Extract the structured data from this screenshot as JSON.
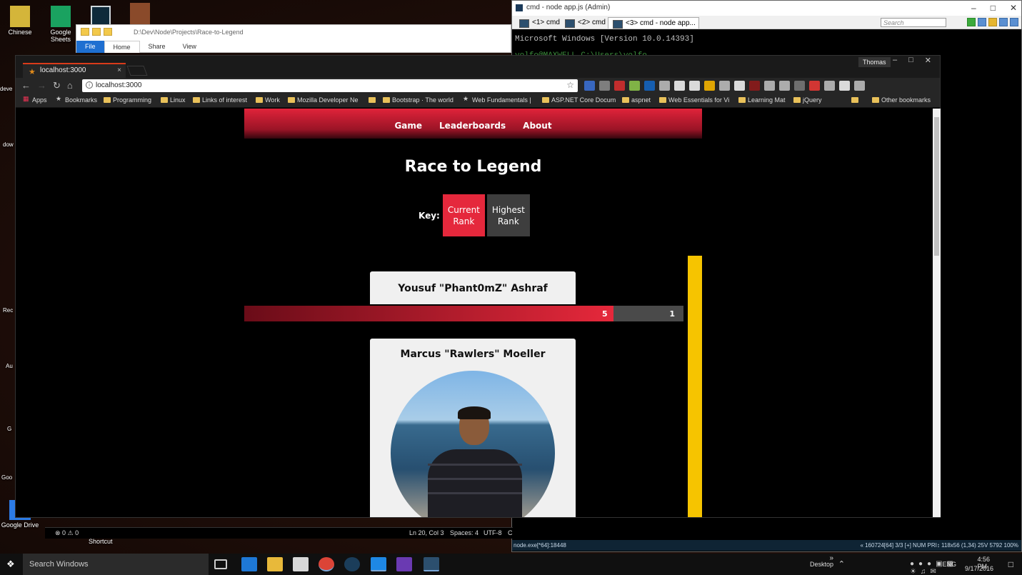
{
  "desktop": {
    "icons": [
      {
        "label": "Chinese",
        "icon": "folder-icon",
        "color": "#d4b53a"
      },
      {
        "label": "Google Sheets",
        "icon": "sheets-icon",
        "color": "#1aa260"
      },
      {
        "label": "Google Drive",
        "icon": "drive-icon",
        "color": "#2c7be5"
      }
    ],
    "fragments": [
      "deve",
      "dow",
      "Rec",
      "Au",
      "G",
      "Goo"
    ]
  },
  "explorer": {
    "path": "D:\\Dev\\Node\\Projects\\Race-to-Legend",
    "tabs": [
      "File",
      "Home",
      "Share",
      "View"
    ]
  },
  "cmd": {
    "title": "cmd - node  app.js (Admin)",
    "tabs": [
      "<1> cmd",
      "<2> cmd",
      "<3> cmd - node  app..."
    ],
    "search_placeholder": "Search",
    "console_lines": [
      "Microsoft Windows [Version 10.0.14393]",
      "yolfo@MAXWELL C:\\Users\\yolfo"
    ],
    "status": {
      "process": "node.exe[*64]:18448",
      "info": "« 160724[64]  3/3  [+]  NUM  PRI↕  118x56   (1,34) 25V   5792  100%"
    },
    "window_controls": [
      "–",
      "□",
      "✕"
    ]
  },
  "chrome": {
    "tab_title": "localhost:3000",
    "tab_close": "×",
    "profile": "Thomas",
    "window_controls": [
      "–",
      "□",
      "✕"
    ],
    "url": "localhost:3000",
    "bookmarks": [
      "Apps",
      "Bookmarks",
      "Programming",
      "Linux",
      "Links of interest",
      "Work",
      "Mozilla Developer Ne",
      "",
      "Bootstrap · The world",
      "Web Fundamentals | ",
      "ASP.NET Core Docum",
      "aspnet",
      "Web Essentials for Vi",
      "Learning Mat",
      "jQuery",
      "»",
      "Other bookmarks"
    ],
    "extension_colors": [
      "#3b6fd1",
      "#888888",
      "#d32f2f",
      "#8bc34a",
      "#1565c0",
      "#bbbbbb",
      "#eeeeee",
      "#eeeeee",
      "#f4b400",
      "#bbbbbb",
      "#eeeeee",
      "#8d1b1b",
      "#bbbbbb",
      "#bbbbbb",
      "#777777",
      "#e53935",
      "#bbbbbb",
      "#eeeeee",
      "#bbbbbb"
    ]
  },
  "site": {
    "nav": [
      "Game",
      "Leaderboards",
      "About"
    ],
    "title": "Race to Legend",
    "key_label": "Key:",
    "key_current": "Current Rank",
    "key_highest": "Highest Rank",
    "colors": {
      "current": "#e5283c",
      "highest": "#3e3e3e",
      "accent": "#f6c400"
    },
    "players": [
      {
        "name": "Yousuf \"Phant0mZ\" Ashraf",
        "current_rank": "5",
        "highest_rank": "1",
        "current_fill_fraction": 0.84
      },
      {
        "name": "Marcus \"Rawlers\" Moeller",
        "avatar": "profile-photo"
      }
    ]
  },
  "vscode_status": {
    "problems": "⊗ 0  ⚠ 0",
    "position": "Ln 20, Col 3",
    "spaces": "Spaces: 4",
    "encoding": "UTF-8",
    "extra": "C"
  },
  "desktop_shortcut": "Shortcut",
  "taskbar": {
    "search_placeholder": "Search Windows",
    "desktop_label": "Desktop",
    "language": "ENG",
    "time": "4:56 PM",
    "date": "9/17/2016",
    "chevron": "»"
  }
}
